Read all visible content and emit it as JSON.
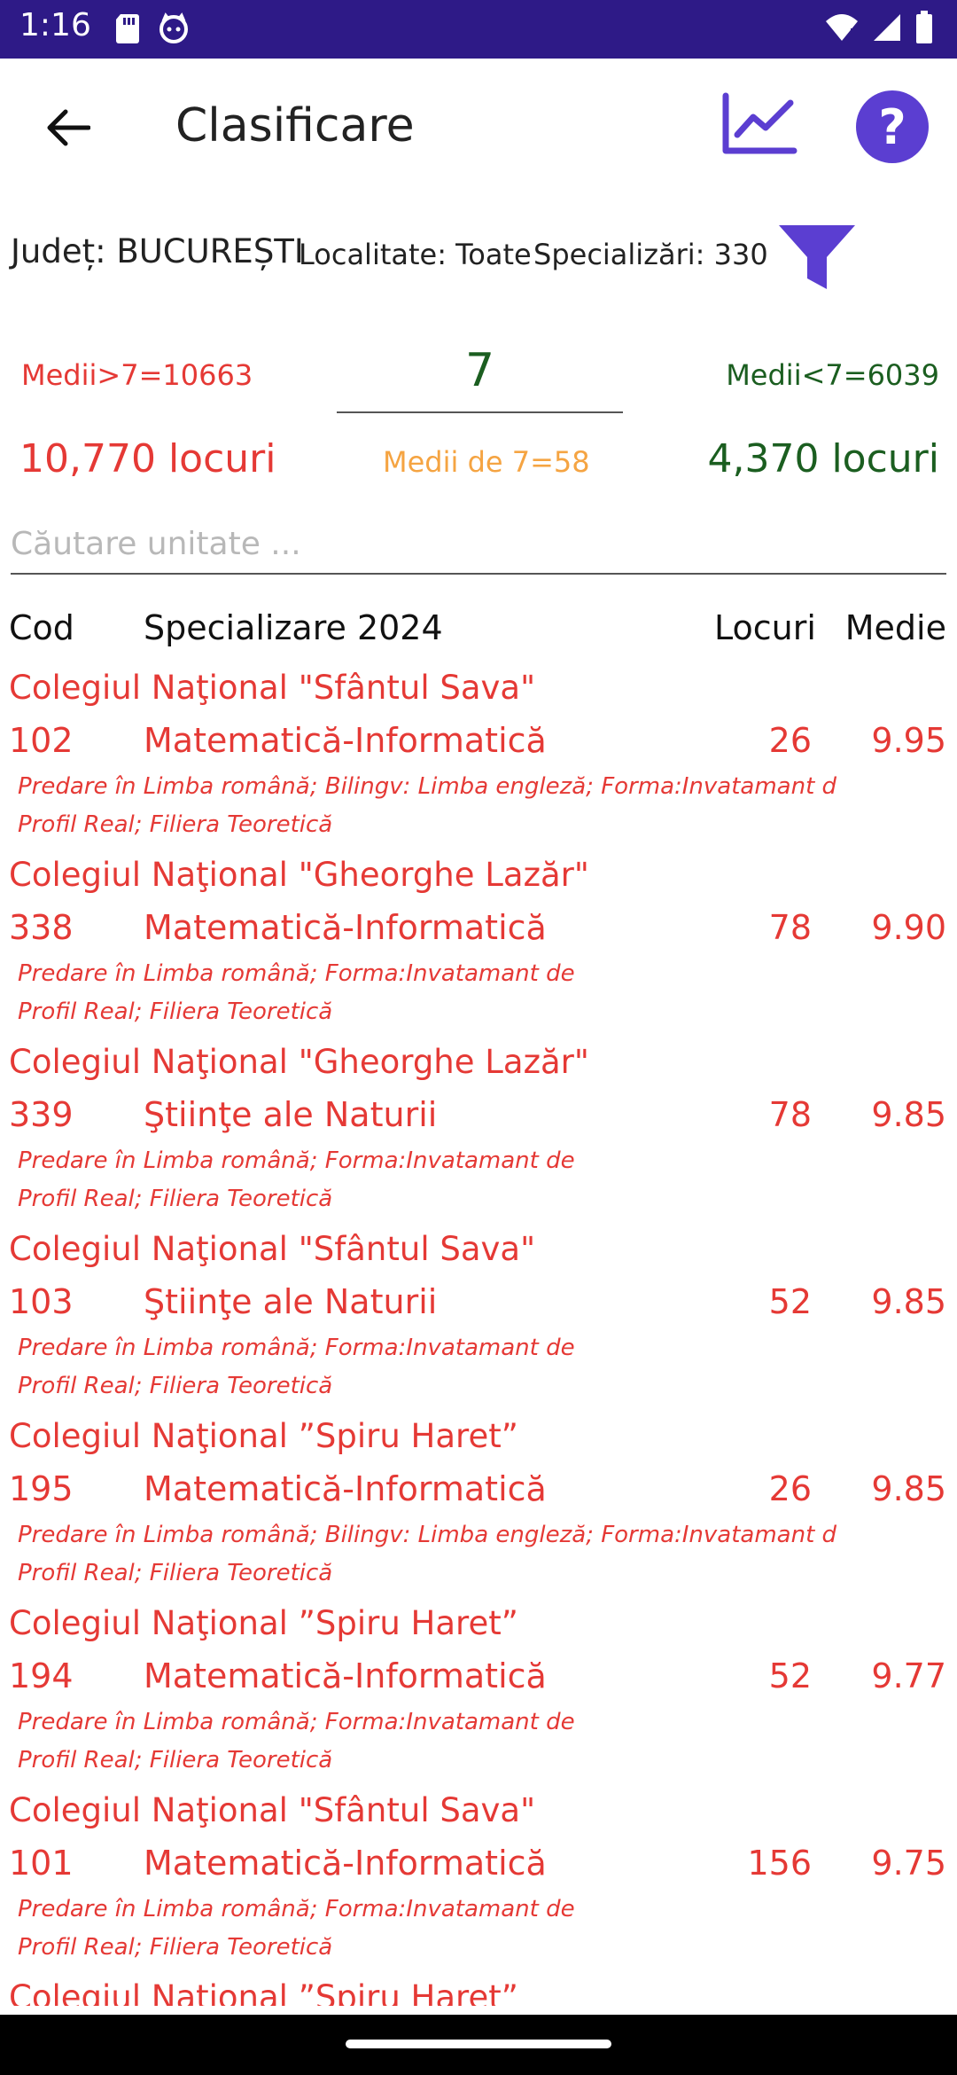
{
  "status_bar": {
    "time": "1:16",
    "left_icons": [
      "sd-card-icon",
      "cat-face-icon"
    ],
    "right_icons": [
      "wifi-icon",
      "signal-icon",
      "battery-icon"
    ]
  },
  "header": {
    "title": "Clasificare",
    "back_icon": "arrow-left-icon",
    "chart_icon": "chart-line-icon",
    "help_label": "?"
  },
  "filters": {
    "judet": "Județ: BUCUREȘTI",
    "localitate": "Localitate: Toate",
    "specializari": "Specializări: 330",
    "filter_icon": "funnel-icon"
  },
  "stats": {
    "medii_gt": "Medii>7=10663",
    "threshold": "7",
    "medii_lt": "Medii<7=6039",
    "locuri_gt": "10,770 locuri",
    "medii_eq": "Medii de 7=58",
    "locuri_lt": "4,370 locuri"
  },
  "search": {
    "placeholder": "Căutare unitate ...",
    "value": ""
  },
  "table": {
    "headers": {
      "cod": "Cod",
      "specializare": "Specializare 2024",
      "locuri": "Locuri",
      "medie": "Medie"
    },
    "rows": [
      {
        "school": "Colegiul Naţional \"Sfântul Sava\"",
        "code": "102",
        "spec": "Matematică-Informatică",
        "locuri": "26",
        "medie": "9.95",
        "detail1": "Predare în Limba română; Bilingv: Limba engleză; Forma:Invatamant de zi",
        "detail2": "Profil Real; Filiera Teoretică"
      },
      {
        "school": "Colegiul Naţional \"Gheorghe Lazăr\"",
        "code": "338",
        "spec": "Matematică-Informatică",
        "locuri": "78",
        "medie": "9.90",
        "detail1": "Predare în Limba română; Forma:Invatamant de zi",
        "detail2": "Profil Real; Filiera Teoretică"
      },
      {
        "school": "Colegiul Naţional \"Gheorghe Lazăr\"",
        "code": "339",
        "spec": "Ştiinţe ale Naturii",
        "locuri": "78",
        "medie": "9.85",
        "detail1": "Predare în Limba română; Forma:Invatamant de zi",
        "detail2": "Profil Real; Filiera Teoretică"
      },
      {
        "school": "Colegiul Naţional \"Sfântul Sava\"",
        "code": "103",
        "spec": "Ştiinţe ale Naturii",
        "locuri": "52",
        "medie": "9.85",
        "detail1": "Predare în Limba română; Forma:Invatamant de zi",
        "detail2": "Profil Real; Filiera Teoretică"
      },
      {
        "school": "Colegiul Naţional ”Spiru Haret”",
        "code": "195",
        "spec": "Matematică-Informatică",
        "locuri": "26",
        "medie": "9.85",
        "detail1": "Predare în Limba română; Bilingv: Limba engleză; Forma:Invatamant de zi",
        "detail2": "Profil Real; Filiera Teoretică"
      },
      {
        "school": "Colegiul Naţional ”Spiru Haret”",
        "code": "194",
        "spec": "Matematică-Informatică",
        "locuri": "52",
        "medie": "9.77",
        "detail1": "Predare în Limba română; Forma:Invatamant de zi",
        "detail2": "Profil Real; Filiera Teoretică"
      },
      {
        "school": "Colegiul Naţional \"Sfântul Sava\"",
        "code": "101",
        "spec": "Matematică-Informatică",
        "locuri": "156",
        "medie": "9.75",
        "detail1": "Predare în Limba română; Forma:Invatamant de zi",
        "detail2": "Profil Real; Filiera Teoretică"
      },
      {
        "school": "Colegiul Naţional ”Spiru Haret”",
        "code": "",
        "spec": "",
        "locuri": "",
        "medie": "",
        "detail1": "",
        "detail2": ""
      }
    ]
  },
  "colors": {
    "accent": "#5b3ed1",
    "status_bar": "#2e1a87",
    "red": "#e53935",
    "green": "#1b5e20",
    "orange": "#f5a442"
  }
}
